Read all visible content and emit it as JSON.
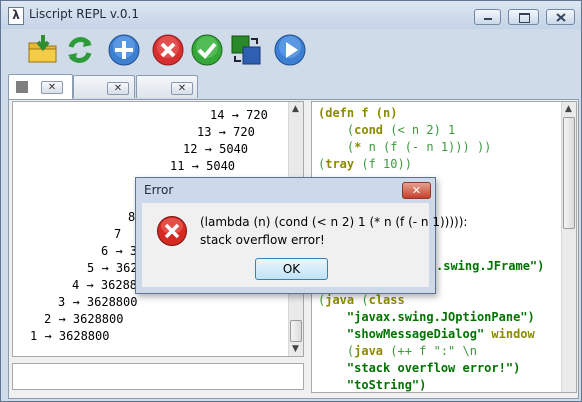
{
  "window": {
    "title": "Liscript REPL v.0.1",
    "app_icon_glyph": "λ"
  },
  "toolbar": {
    "buttons": [
      {
        "name": "open-file-button",
        "icon": "folder-download-icon"
      },
      {
        "name": "reload-button",
        "icon": "refresh-icon"
      },
      {
        "name": "new-tab-button",
        "icon": "plus-icon"
      },
      {
        "name": "close-tab-button",
        "icon": "cancel-icon"
      },
      {
        "name": "run-button",
        "icon": "check-icon"
      },
      {
        "name": "window-button",
        "icon": "windows-icon"
      },
      {
        "name": "evaluate-button",
        "icon": "play-icon"
      }
    ]
  },
  "tabs": [
    {
      "close_glyph": "✕"
    },
    {
      "close_glyph": "✕"
    },
    {
      "close_glyph": "✕"
    }
  ],
  "results": [
    "14 → 720",
    "13 → 720",
    "12 → 5040",
    "11 → 5040",
    "8",
    "7",
    "6 → 3",
    "5 → 362",
    "4 → 3628800",
    "3 → 3628800",
    "2 → 3628800",
    "1 → 3628800"
  ],
  "code_lines": [
    {
      "parts": [
        {
          "t": "(defn f (n)",
          "c": "kw"
        }
      ]
    },
    {
      "parts": [
        {
          "t": "    (",
          "c": "par"
        },
        {
          "t": "cond",
          "c": "kw"
        },
        {
          "t": " (< n 2) 1",
          "c": "par"
        }
      ]
    },
    {
      "parts": [
        {
          "t": "    (",
          "c": "par"
        },
        {
          "t": "*",
          "c": "kw"
        },
        {
          "t": " n (f (- n 1))) ))",
          "c": "par"
        }
      ]
    },
    {
      "parts": [
        {
          "t": "(",
          "c": "par"
        },
        {
          "t": "tray",
          "c": "kw"
        },
        {
          "t": " (f 10))",
          "c": "par"
        }
      ]
    },
    {
      "parts": [
        {
          "t": ".swing.JFrame\")",
          "c": "str"
        }
      ]
    },
    {
      "parts": [
        {
          "t": "(",
          "c": "par"
        },
        {
          "t": "java",
          "c": "kw"
        },
        {
          "t": " (",
          "c": "par"
        },
        {
          "t": "class",
          "c": "kw"
        }
      ]
    },
    {
      "parts": [
        {
          "t": "    \"javax.swing.JOptionPane\")",
          "c": "str"
        }
      ]
    },
    {
      "parts": [
        {
          "t": "    \"showMessageDialog\"",
          "c": "str"
        },
        {
          "t": " window",
          "c": "kw"
        }
      ]
    },
    {
      "parts": [
        {
          "t": "    (",
          "c": "par"
        },
        {
          "t": "java",
          "c": "kw"
        },
        {
          "t": " (++ f \":\" \\n",
          "c": "par"
        }
      ]
    },
    {
      "parts": [
        {
          "t": "    \"stack overflow error!\")",
          "c": "str"
        }
      ]
    },
    {
      "parts": [
        {
          "t": "    \"toString\")",
          "c": "str"
        }
      ]
    }
  ],
  "dialog": {
    "title": "Error",
    "close_glyph": "✕",
    "message_line1": "(lambda (n) (cond (< n 2) 1 (* n (f (- n 1))))):",
    "message_line2": "stack overflow error!",
    "ok_label": "OK",
    "icon": "error-x-icon"
  }
}
